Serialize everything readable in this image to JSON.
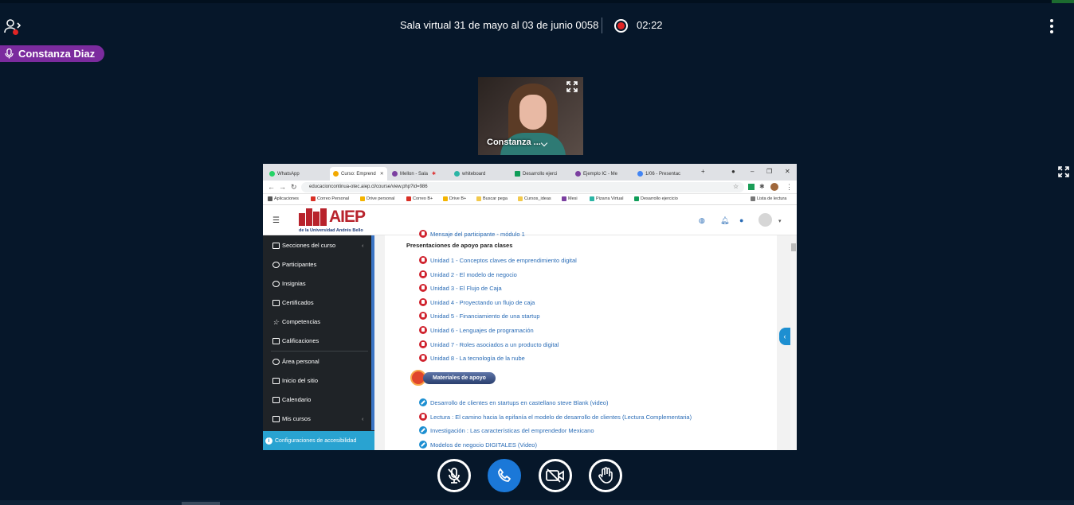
{
  "header": {
    "title": "Sala virtual 31 de mayo al 03 de junio 0058",
    "timer": "02:22"
  },
  "speaker": {
    "name": "Constanza Diaz"
  },
  "webcam": {
    "name": "Constanza ..."
  },
  "browser": {
    "tabs": [
      {
        "label": "WhatsApp",
        "color": "#25d366"
      },
      {
        "label": "Curso: Emprend",
        "color": "#f2a900"
      },
      {
        "label": "Mellon - Sala",
        "color": "#7b3fa0"
      },
      {
        "label": "whiteboard",
        "color": "#2bb5a5"
      },
      {
        "label": "Desarrollo ejerci",
        "color": "#0f9d58"
      },
      {
        "label": "Ejemplo IC - Me",
        "color": "#7b3fa0"
      },
      {
        "label": "1/06 - Presentac",
        "color": "#4285f4"
      }
    ],
    "new_tab": "+",
    "url": "educacioncontinua-otec.aiep.cl/course/view.php?id=986",
    "bookmarks": [
      {
        "label": "Aplicaciones",
        "color": "#555555"
      },
      {
        "label": "Correo Personal",
        "color": "#d93025"
      },
      {
        "label": "Drive personal",
        "color": "#f4b400"
      },
      {
        "label": "Correo B+",
        "color": "#d93025"
      },
      {
        "label": "Drive B+",
        "color": "#f4b400"
      },
      {
        "label": "Buscar pega",
        "color": "#f2c94c"
      },
      {
        "label": "Cursos_ideas",
        "color": "#f2c94c"
      },
      {
        "label": "Mesi",
        "color": "#7b3fa0"
      },
      {
        "label": "Pizarra Virtual",
        "color": "#2bb5a5"
      },
      {
        "label": "Desarrollo ejercicio",
        "color": "#0f9d58"
      }
    ],
    "reading_list": "Lista de lectura"
  },
  "moodle": {
    "logo_text": "AIEP",
    "logo_sub": "de la Universidad Andrés Bello",
    "sidebar": {
      "items": [
        {
          "label": "Secciones del curso"
        },
        {
          "label": "Participantes"
        },
        {
          "label": "Insignias"
        },
        {
          "label": "Certificados"
        },
        {
          "label": "Competencias"
        },
        {
          "label": "Calificaciones"
        },
        {
          "label": "Área personal"
        },
        {
          "label": "Inicio del sitio"
        },
        {
          "label": "Calendario"
        },
        {
          "label": "Mis cursos"
        }
      ],
      "accessibility": "Configuraciones de accesibilidad"
    },
    "content": {
      "cut_item": "Mensaje del participante - módulo 1",
      "section_title": "Presentaciones de apoyo para clases",
      "units": [
        "Unidad 1 - Conceptos claves de emprendimiento digital",
        "Unidad 2 - El modelo de negocio",
        "Unidad 3 - El Flujo de Caja",
        "Unidad 4 - Proyectando un flujo de caja",
        "Unidad 5 - Financiamiento de una startup",
        "Unidad 6 - Lenguajes de programación",
        "Unidad 7 - Roles asociados a un producto digital",
        "Unidad 8 - La tecnología de la nube"
      ],
      "materials_label": "Materiales de apoyo",
      "materials": [
        {
          "label": "Desarrollo de clientes en startups en castellano steve Blank (video)",
          "type": "link"
        },
        {
          "label": "Lectura : El camino hacia la epifanía el modelo de desarrollo de clientes (Lectura Complementaria)",
          "type": "pdf"
        },
        {
          "label": "Investigación : Las características del emprendedor Mexicano",
          "type": "link"
        },
        {
          "label": "Modelos de negocio DIGITALES (Video)",
          "type": "link"
        }
      ]
    }
  },
  "colors": {
    "background": "#06172a",
    "speaker_badge": "#7b2b9e",
    "record": "#e02424",
    "call_button": "#1b78d8",
    "aiep_red": "#b8232c",
    "link_blue": "#2a6cb6"
  }
}
